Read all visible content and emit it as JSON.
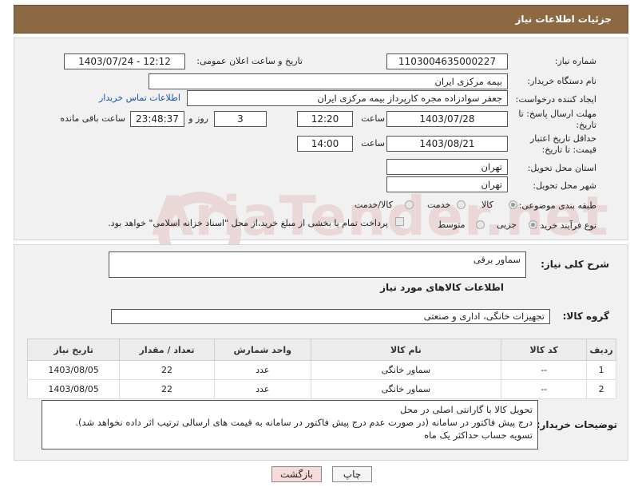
{
  "header": {
    "title": "جزئیات اطلاعات نیاز"
  },
  "form": {
    "need_number_label": "شماره نیاز:",
    "need_number": "1103004635000227",
    "announce_label": "تاریخ و ساعت اعلان عمومی:",
    "announce_value": "1403/07/24 - 12:12",
    "buyer_org_label": "نام دستگاه خریدار:",
    "buyer_org": "بیمه مرکزی ایران",
    "creator_label": "ایجاد کننده درخواست:",
    "creator": "جعفر سوادزاده مجره کارپرداز بیمه مرکزی ایران",
    "contact_link": "اطلاعات تماس خریدار",
    "reply_deadline_label": "مهلت ارسال پاسخ: تا تاریخ:",
    "reply_date": "1403/07/28",
    "time_label": "ساعت",
    "reply_time": "12:20",
    "days_value": "3",
    "days_label": "روز و",
    "remaining_time": "23:48:37",
    "remaining_label": "ساعت باقی مانده",
    "validity_label": "حداقل تاریخ اعتبار قیمت: تا تاریخ:",
    "validity_date": "1403/08/21",
    "validity_time": "14:00",
    "province_label": "استان محل تحویل:",
    "province": "تهران",
    "city_label": "شهر محل تحویل:",
    "city": "تهران",
    "category_label": "طبقه بندی موضوعی:",
    "category_options": [
      "کالا",
      "خدمت",
      "کالا/خدمت"
    ],
    "category_selected": "کالا",
    "process_label": "نوع فرآیند خرید :",
    "process_options": [
      "جزیی",
      "متوسط"
    ],
    "payment_note": "پرداخت تمام یا بخشی از مبلغ خرید،از محل \"اسناد خزانه اسلامی\" خواهد بود."
  },
  "summary": {
    "label": "شرح کلی نیاز:",
    "value": "سماور برقی"
  },
  "goods": {
    "section_title": "اطلاعات کالاهای مورد نیاز",
    "group_label": "گروه کالا:",
    "group_value": "تجهیزات خانگی، اداری و صنعتی",
    "columns": [
      "ردیف",
      "کد کالا",
      "نام کالا",
      "واحد شمارش",
      "تعداد / مقدار",
      "تاریخ نیاز"
    ],
    "rows": [
      [
        "1",
        "--",
        "سماور خانگی",
        "عدد",
        "22",
        "1403/08/05"
      ],
      [
        "2",
        "--",
        "سماور خانگی",
        "عدد",
        "22",
        "1403/08/05"
      ]
    ]
  },
  "notes": {
    "label": "توضیحات خریدار:",
    "lines": [
      "تحویل کالا با گارانتی اصلی در محل",
      "درج پیش فاکتور در سامانه (در صورت عدم درج پیش فاکتور در سامانه به قیمت های ارسالی ترتیب اثر داده نخواهد شد).",
      "تسویه حساب حداکثر یک ماه"
    ]
  },
  "buttons": {
    "print": "چاپ",
    "back": "بازگشت"
  },
  "watermark": "AriaTender.net",
  "colors": {
    "header_bg": "#8b6a43",
    "back_btn_bg": "#f7dada",
    "link": "#1a55b0"
  }
}
